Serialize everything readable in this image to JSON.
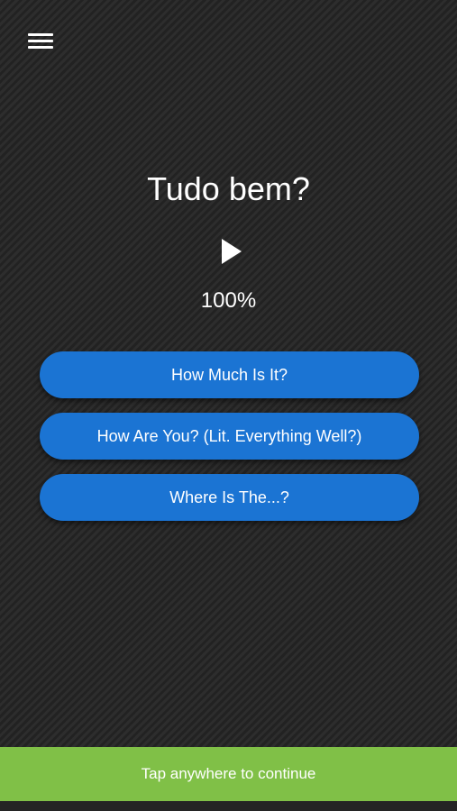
{
  "header": {
    "menu_icon": "hamburger-menu-icon"
  },
  "question": {
    "phrase": "Tudo bem?",
    "play_icon": "play-icon",
    "score": "100%"
  },
  "answers": [
    {
      "label": "How Much Is It?"
    },
    {
      "label": "How Are You? (Lit. Everything Well?)"
    },
    {
      "label": "Where Is The...?"
    }
  ],
  "footer": {
    "continue_label": "Tap anywhere to continue"
  },
  "colors": {
    "background": "#2a2a2a",
    "answer_button": "#1b74d3",
    "continue_bar": "#80c047",
    "text": "#ffffff"
  }
}
